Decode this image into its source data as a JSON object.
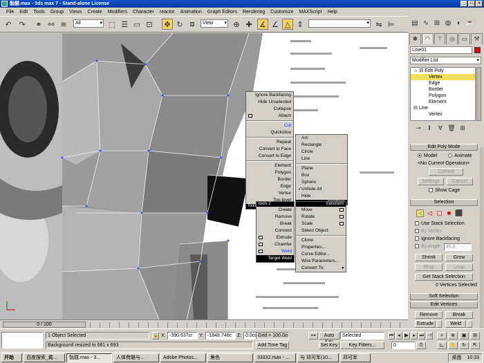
{
  "app": {
    "title": "骷髅.max - 3ds max 7 - Stand-alone License"
  },
  "menu": [
    "File",
    "Edit",
    "Tools",
    "Group",
    "Views",
    "Create",
    "Modifiers",
    "Character",
    "reactor",
    "Animation",
    "Graph Editors",
    "Rendering",
    "Customize",
    "MAXScript",
    "Help"
  ],
  "toolbar": {
    "selection_filter": "All",
    "ref_coord": "View"
  },
  "viewport": {
    "timeslider": "0 / 100",
    "quad": {
      "top_right": [
        "Ignore Backfacing",
        "Hide Unselected",
        "Collapse",
        "Attach",
        "Cut",
        "Quickslice",
        "Repeat",
        "Convert to Face",
        "Convert to Edge",
        "Element",
        "Polygon",
        "Border",
        "Edge",
        "Vertex",
        "Top-level"
      ],
      "label_tools1": "tools 1",
      "label_primitives": "primitives",
      "submenu": [
        "Arc",
        "Rectangle",
        "Circle",
        "Line",
        "Plane",
        "Box",
        "Sphere",
        "Unhide All",
        "Hide"
      ],
      "label_tools2": "tools 2",
      "label_transform": "transform",
      "bottom_left": [
        "Create",
        "Remove",
        "Break",
        "Connect",
        "Extrude",
        "Chamfer",
        "Weld",
        "Target Weld"
      ],
      "bottom_right": [
        "Move",
        "Rotate",
        "Scale",
        "Select Object",
        "Clone",
        "Properties...",
        "Curve Editor...",
        "Wire Parameters...",
        "Convert To:"
      ]
    }
  },
  "panel": {
    "object_name": "Line01",
    "modifier_list": "Modifier List",
    "stack": [
      "Edit Poly",
      "Vertex",
      "Edge",
      "Border",
      "Polygon",
      "Element",
      "Line",
      "Vertex"
    ],
    "edit_poly_mode": "Edit Poly Mode",
    "model": "Model",
    "animate": "Animate",
    "no_op": "<No Current Operation>",
    "commit": "Commit",
    "settings": "Settings",
    "cancel": "Cancel",
    "show_cage": "Show Cage",
    "selection": "Selection",
    "use_stack": "Use Stack Selection",
    "by_vertex": "By Vertex",
    "ignore_backfacing": "Ignore Backfacing",
    "by_angle": "By Angle:",
    "angle_value": "45.0",
    "shrink": "Shrink",
    "grow": "Grow",
    "ring": "Ring",
    "loop": "Loop",
    "get_stack": "Get Stack Selection",
    "selected_count": "0 Vertices Selected",
    "soft_selection": "Soft Selection",
    "edit_vertices": "Edit Vertices",
    "remove": "Remove",
    "break": "Break",
    "extrude": "Extrude",
    "weld": "Weld"
  },
  "status": {
    "selected": "1 Object Selected",
    "prompt": "Background resized to 681 x 693",
    "x_label": "X:",
    "x": "-390.637cr",
    "y_label": "Y:",
    "y": "-1848.746c",
    "z_label": "Z:",
    "z": "0.0cm",
    "grid": "Grid = 100.0cm",
    "add_time_tag": "Add Time Tag",
    "auto_key": "Auto Key",
    "set_key": "Set Key",
    "key_mode": "Selected",
    "key_filters": "Key Filters...",
    "frame": "0"
  },
  "taskbar": {
    "start": "开始",
    "items": [
      "百度搜索_戴...",
      "骷髅.max - 3...",
      "人体骨骼与...",
      "Adobe Photos...",
      "角色",
      "33332.max - ...",
      "与 邓可军(10...",
      "邓可军"
    ],
    "tray_label": "桌面",
    "time": "10:33"
  }
}
